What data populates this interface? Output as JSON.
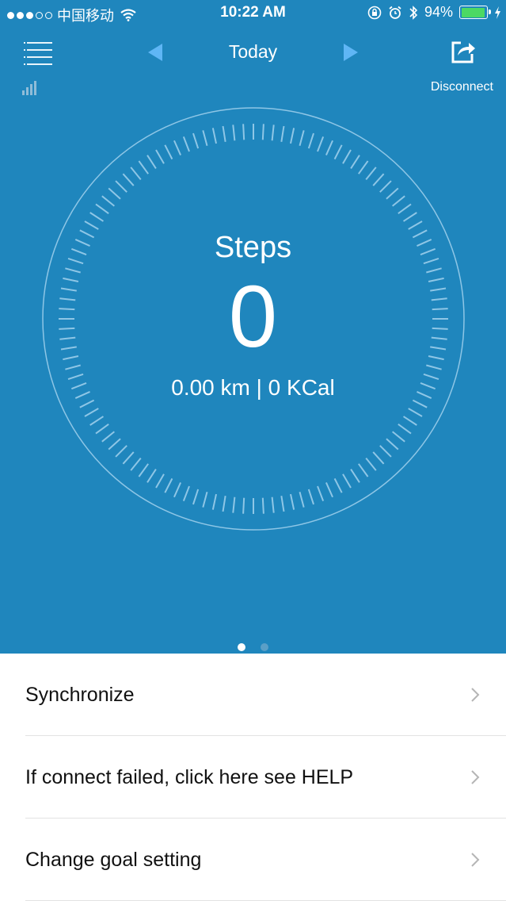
{
  "status_bar": {
    "carrier": "中国移动",
    "time": "10:22 AM",
    "battery_percent": "94%",
    "battery_level": 0.94,
    "signal_dots_filled": 3,
    "signal_dots_total": 5
  },
  "nav": {
    "title": "Today",
    "disconnect_label": "Disconnect"
  },
  "activity": {
    "steps_label": "Steps",
    "steps_value": "0",
    "stats": "0.00 km | 0 KCal"
  },
  "pager": {
    "pages": 2,
    "active_index": 0
  },
  "menu": {
    "items": [
      {
        "label": "Synchronize"
      },
      {
        "label": "If connect failed, click here see HELP"
      },
      {
        "label": "Change goal setting"
      }
    ]
  },
  "colors": {
    "primary_blue": "#1f86bd",
    "arrow_blue": "#5fb6f5",
    "battery_green": "#4cd964"
  }
}
